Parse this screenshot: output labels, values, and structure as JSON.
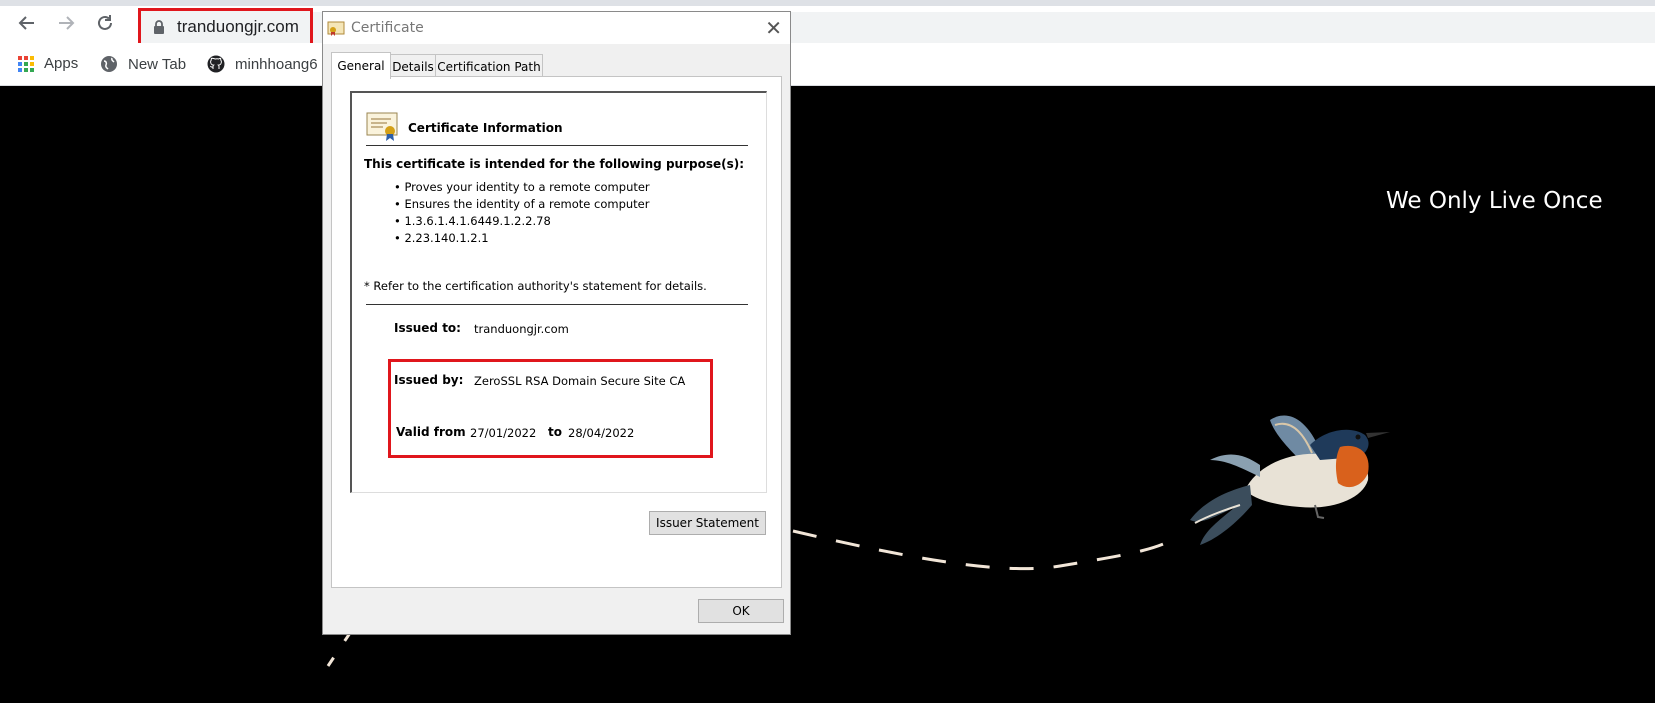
{
  "browser": {
    "url": "tranduongjr.com",
    "bookmarks": [
      {
        "label": "Apps",
        "icon": "apps-grid-icon"
      },
      {
        "label": "New Tab",
        "icon": "globe-icon"
      },
      {
        "label": "minhhoang6",
        "icon": "github-icon"
      }
    ]
  },
  "page": {
    "headline": "We Only Live Once"
  },
  "dialog": {
    "title": "Certificate",
    "tabs": [
      "General",
      "Details",
      "Certification Path"
    ],
    "info_heading": "Certificate Information",
    "purpose_heading": "This certificate is intended for the following purpose(s):",
    "purposes": [
      "Proves your identity to a remote computer",
      "Ensures the identity of a remote computer",
      "1.3.6.1.4.1.6449.1.2.2.78",
      "2.23.140.1.2.1"
    ],
    "note": "* Refer to the certification authority's statement for details.",
    "issued_to_label": "Issued to:",
    "issued_to": "tranduongjr.com",
    "issued_by_label": "Issued by:",
    "issued_by": "ZeroSSL RSA Domain Secure Site CA",
    "valid_from_label": "Valid from",
    "valid_from": "27/01/2022",
    "to_label": "to",
    "valid_to": "28/04/2022",
    "issuer_statement_button": "Issuer Statement",
    "ok_button": "OK"
  }
}
